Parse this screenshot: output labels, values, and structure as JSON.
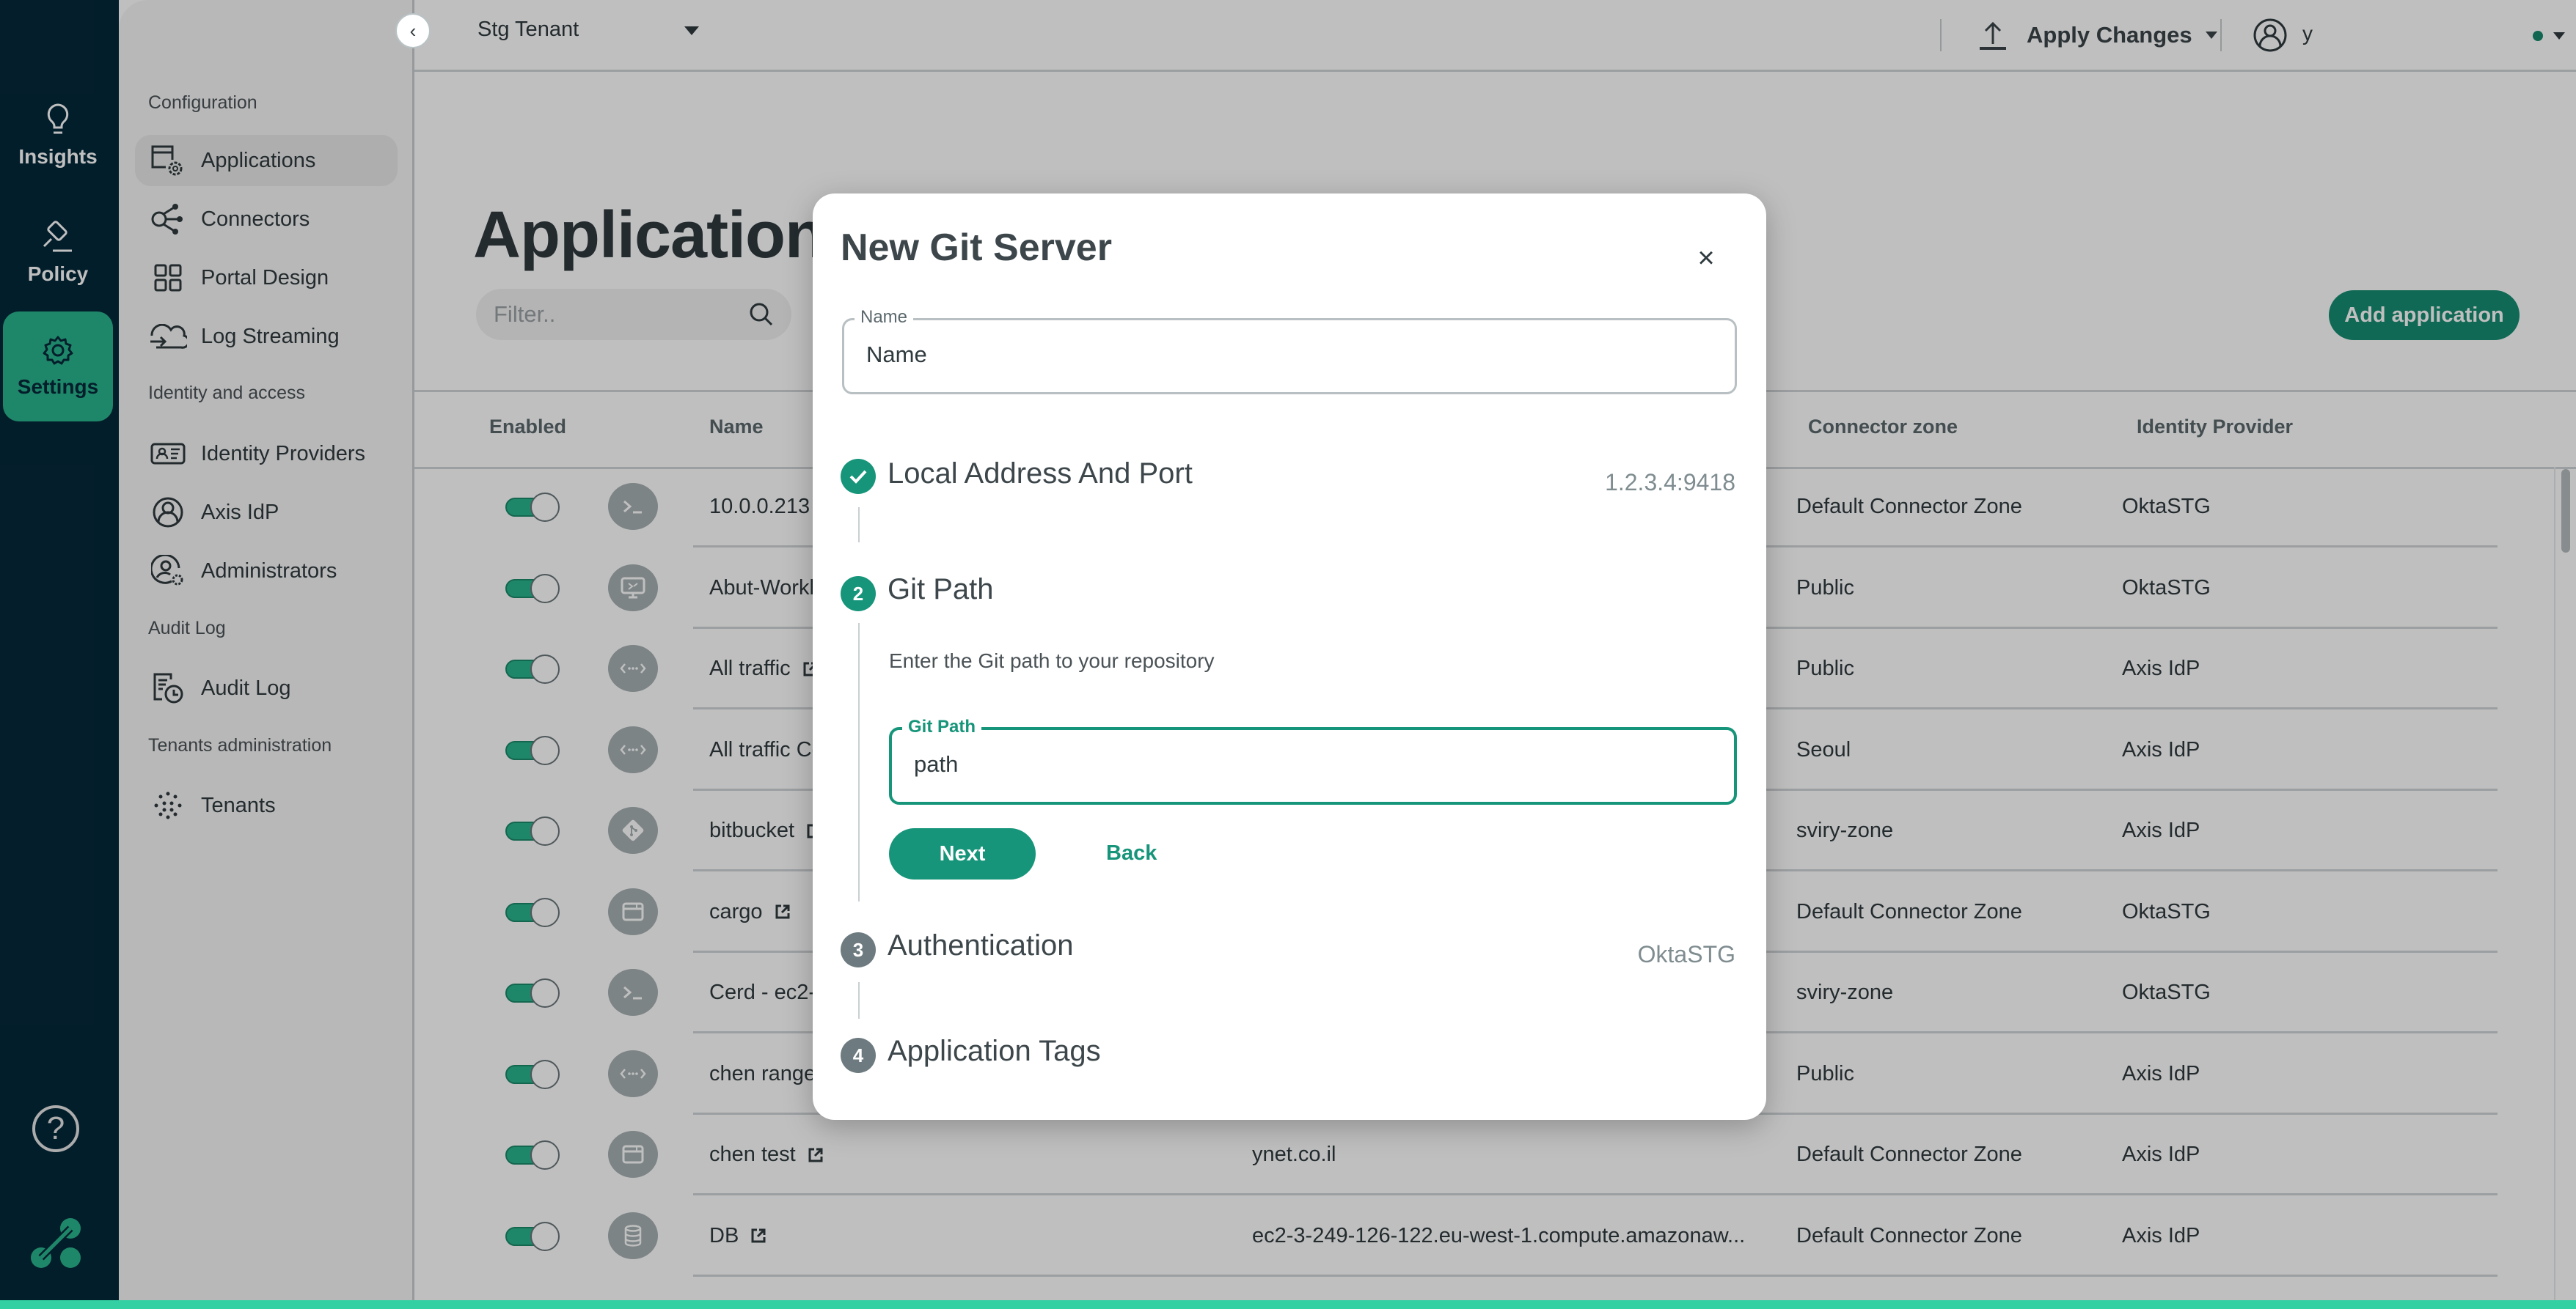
{
  "rail": {
    "items": [
      {
        "label": "Insights",
        "icon": "lightbulb-icon",
        "active": false
      },
      {
        "label": "Policy",
        "icon": "gavel-icon",
        "active": false
      },
      {
        "label": "Settings",
        "icon": "gear-icon",
        "active": true
      }
    ],
    "help_label": "?"
  },
  "subnav": {
    "sections": [
      {
        "title": "Configuration",
        "items": [
          {
            "label": "Applications",
            "icon": "app-settings-icon",
            "active": true
          },
          {
            "label": "Connectors",
            "icon": "share-nodes-icon"
          },
          {
            "label": "Portal Design",
            "icon": "grid-icon"
          },
          {
            "label": "Log Streaming",
            "icon": "cloud-arrow-icon"
          }
        ]
      },
      {
        "title": "Identity and access",
        "items": [
          {
            "label": "Identity Providers",
            "icon": "id-card-icon"
          },
          {
            "label": "Axis IdP",
            "icon": "user-circle-icon"
          },
          {
            "label": "Administrators",
            "icon": "user-gear-icon"
          }
        ]
      },
      {
        "title": "Audit Log",
        "items": [
          {
            "label": "Audit Log",
            "icon": "log-clock-icon"
          }
        ]
      },
      {
        "title": "Tenants administration",
        "items": [
          {
            "label": "Tenants",
            "icon": "dots-cluster-icon"
          }
        ]
      }
    ]
  },
  "topbar": {
    "tenant": "Stg Tenant",
    "apply_label": "Apply Changes",
    "user_name": "y",
    "status_color": "#16896b"
  },
  "page": {
    "title": "Application settings",
    "filter_placeholder": "Filter..",
    "add_label": "Add application"
  },
  "table": {
    "headers": {
      "enabled": "Enabled",
      "name": "Name",
      "zone": "Connector zone",
      "idp": "Identity Provider"
    },
    "rows": [
      {
        "enabled": true,
        "icon": "terminal-icon",
        "name": "10.0.0.213",
        "external": false,
        "address": "",
        "zone": "Default Connector Zone",
        "idp": "OktaSTG"
      },
      {
        "enabled": true,
        "icon": "remote-desktop-icon",
        "name": "Abut-Workl",
        "external": false,
        "address": "",
        "zone": "Public",
        "idp": "OktaSTG"
      },
      {
        "enabled": true,
        "icon": "network-range-icon",
        "name": "All traffic",
        "external": true,
        "address": "",
        "zone": "Public",
        "idp": "Axis IdP"
      },
      {
        "enabled": true,
        "icon": "network-range-icon",
        "name": "All traffic Co",
        "external": false,
        "address": "",
        "zone": "Seoul",
        "idp": "Axis IdP"
      },
      {
        "enabled": true,
        "icon": "git-icon",
        "name": "bitbucket",
        "external": true,
        "address": "",
        "zone": "sviry-zone",
        "idp": "Axis IdP"
      },
      {
        "enabled": true,
        "icon": "browser-window-icon",
        "name": "cargo",
        "external": true,
        "address": "",
        "zone": "Default Connector Zone",
        "idp": "OktaSTG"
      },
      {
        "enabled": true,
        "icon": "terminal-icon",
        "name": "Cerd - ec2-",
        "external": false,
        "address": "",
        "zone": "sviry-zone",
        "idp": "OktaSTG"
      },
      {
        "enabled": true,
        "icon": "network-range-icon",
        "name": "chen range",
        "external": false,
        "address": "",
        "zone": "Public",
        "idp": "Axis IdP"
      },
      {
        "enabled": true,
        "icon": "browser-window-icon",
        "name": "chen test",
        "external": true,
        "address": "ynet.co.il",
        "zone": "Default Connector Zone",
        "idp": "Axis IdP"
      },
      {
        "enabled": true,
        "icon": "database-icon",
        "name": "DB",
        "external": true,
        "address": "ec2-3-249-126-122.eu-west-1.compute.amazonaw...",
        "zone": "Default Connector Zone",
        "idp": "Axis IdP"
      }
    ]
  },
  "modal": {
    "title": "New Git Server",
    "name_field": {
      "label": "Name",
      "value": "Name"
    },
    "steps": [
      {
        "number": "1",
        "title": "Local Address And Port",
        "value": "1.2.3.4:9418",
        "state": "done"
      },
      {
        "number": "2",
        "title": "Git Path",
        "value": "",
        "state": "current"
      },
      {
        "number": "3",
        "title": "Authentication",
        "value": "OktaSTG",
        "state": "todo"
      },
      {
        "number": "4",
        "title": "Application Tags",
        "value": "",
        "state": "todo"
      }
    ],
    "git_path_desc": "Enter the Git path to your repository",
    "git_path_field": {
      "label": "Git Path",
      "value": "path"
    },
    "next_label": "Next",
    "back_label": "Back"
  }
}
